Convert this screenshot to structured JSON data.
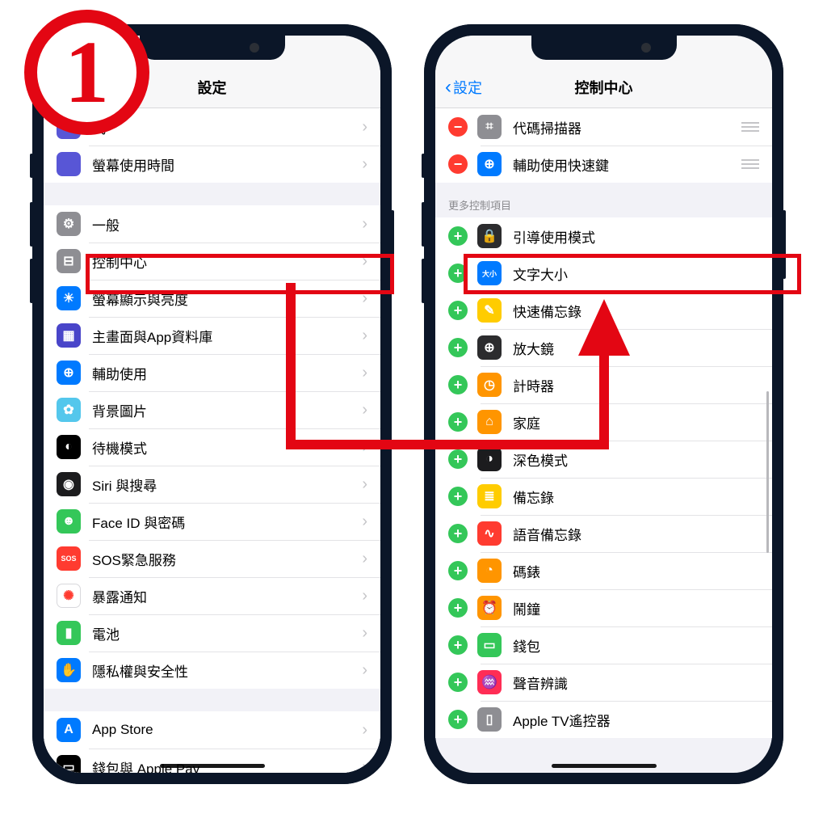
{
  "step_number": "1",
  "phone1": {
    "title": "設定",
    "groups": [
      {
        "rows": [
          {
            "id": "focus",
            "label": "式",
            "icon_bg": "#5856d6"
          },
          {
            "id": "screentime",
            "label": "螢幕使用時間",
            "icon_bg": "#5856d6"
          }
        ]
      },
      {
        "rows": [
          {
            "id": "general",
            "label": "一般",
            "icon_bg": "#8e8e93",
            "glyph": "⚙"
          },
          {
            "id": "control-center",
            "label": "控制中心",
            "icon_bg": "#8e8e93",
            "glyph": "⊟"
          },
          {
            "id": "display",
            "label": "螢幕顯示與亮度",
            "icon_bg": "#007aff",
            "glyph": "☀"
          },
          {
            "id": "homescreen",
            "label": "主畫面與App資料庫",
            "icon_bg": "#4945c9",
            "glyph": "▦"
          },
          {
            "id": "accessibility",
            "label": "輔助使用",
            "icon_bg": "#007aff",
            "glyph": "⊕"
          },
          {
            "id": "wallpaper",
            "label": "背景圖片",
            "icon_bg": "#54c7ec",
            "glyph": "✿"
          },
          {
            "id": "standby",
            "label": "待機模式",
            "icon_bg": "#000",
            "glyph": "◐"
          },
          {
            "id": "siri",
            "label": "Siri 與搜尋",
            "icon_bg": "#1c1c1e",
            "glyph": "◉"
          },
          {
            "id": "faceid",
            "label": "Face ID 與密碼",
            "icon_bg": "#34c759",
            "glyph": "☻"
          },
          {
            "id": "sos",
            "label": "SOS緊急服務",
            "icon_bg": "#ff3b30",
            "glyph_text": "SOS"
          },
          {
            "id": "exposure",
            "label": "暴露通知",
            "icon_bg": "#fff",
            "glyph": "✺",
            "glyph_color": "#ff3b30",
            "border": true
          },
          {
            "id": "battery",
            "label": "電池",
            "icon_bg": "#34c759",
            "glyph": "▮"
          },
          {
            "id": "privacy",
            "label": "隱私權與安全性",
            "icon_bg": "#007aff",
            "glyph": "✋"
          }
        ]
      },
      {
        "rows": [
          {
            "id": "appstore",
            "label": "App Store",
            "icon_bg": "#007aff",
            "glyph": "A"
          },
          {
            "id": "wallet",
            "label": "錢包與 Apple Pay",
            "icon_bg": "#000",
            "glyph": "▭"
          }
        ]
      }
    ]
  },
  "phone2": {
    "title": "控制中心",
    "back_label": "設定",
    "included_rows": [
      {
        "id": "code-scanner",
        "label": "代碼掃描器",
        "icon_bg": "#8e8e93",
        "glyph": "⌗"
      },
      {
        "id": "ax-shortcut",
        "label": "輔助使用快速鍵",
        "icon_bg": "#007aff",
        "glyph": "⊕"
      }
    ],
    "more_section_label": "更多控制項目",
    "more_rows": [
      {
        "id": "guided-access",
        "label": "引導使用模式",
        "icon_bg": "#2c2c2e",
        "glyph": "🔒"
      },
      {
        "id": "text-size",
        "label": "文字大小",
        "icon_bg": "#007aff",
        "glyph_text": "大小"
      },
      {
        "id": "quick-note",
        "label": "快速備忘錄",
        "icon_bg": "#ffcc00",
        "glyph": "✎"
      },
      {
        "id": "magnifier",
        "label": "放大鏡",
        "icon_bg": "#2c2c2e",
        "glyph": "⊕"
      },
      {
        "id": "timer",
        "label": "計時器",
        "icon_bg": "#ff9500",
        "glyph": "◷"
      },
      {
        "id": "home",
        "label": "家庭",
        "icon_bg": "#ff9500",
        "glyph": "⌂"
      },
      {
        "id": "dark-mode",
        "label": "深色模式",
        "icon_bg": "#1c1c1e",
        "glyph": "◑"
      },
      {
        "id": "notes",
        "label": "備忘錄",
        "icon_bg": "#ffcc00",
        "glyph": "≣"
      },
      {
        "id": "voice-memos",
        "label": "語音備忘錄",
        "icon_bg": "#ff3b30",
        "glyph": "∿"
      },
      {
        "id": "stopwatch",
        "label": "碼錶",
        "icon_bg": "#ff9500",
        "glyph": "◔"
      },
      {
        "id": "alarm",
        "label": "鬧鐘",
        "icon_bg": "#ff9500",
        "glyph": "⏰"
      },
      {
        "id": "wallet2",
        "label": "錢包",
        "icon_bg": "#34c759",
        "glyph": "▭"
      },
      {
        "id": "sound-recognition",
        "label": "聲音辨識",
        "icon_bg": "#ff2d55",
        "glyph": "♒"
      },
      {
        "id": "apple-tv-remote",
        "label": "Apple TV遙控器",
        "icon_bg": "#8e8e93",
        "glyph": "▯"
      }
    ]
  }
}
